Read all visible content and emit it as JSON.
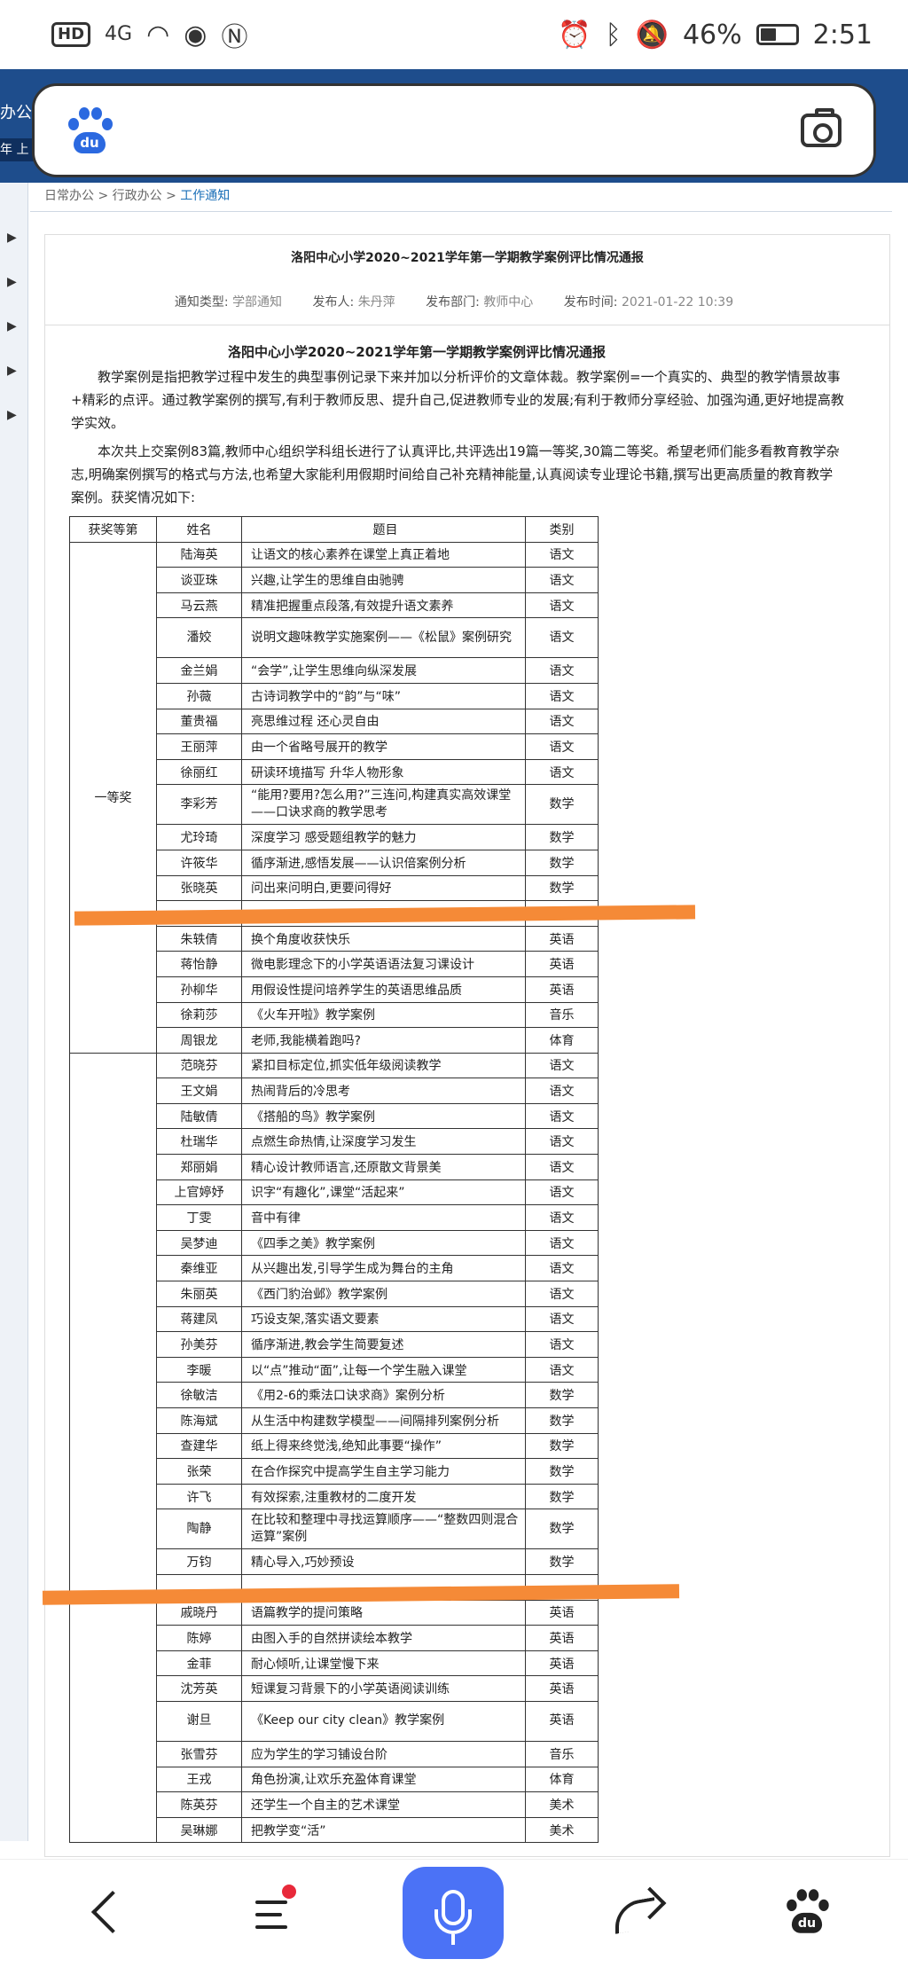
{
  "status_bar": {
    "network": "HD",
    "signal": "4G",
    "battery": "46%",
    "time": "2:51"
  },
  "left_edge": {
    "label_top": "办公",
    "label_mid": "年 上"
  },
  "search": {
    "logo_text": "du"
  },
  "breadcrumb": {
    "item1": "日常办公",
    "sep": ">",
    "item2": "行政办公",
    "item3": "工作通知"
  },
  "notice": {
    "title": "洛阳中心小学2020~2021学年第一学期教学案例评比情况通报",
    "type_label": "通知类型:",
    "type_value": "学部通知",
    "publisher_label": "发布人:",
    "publisher_value": "朱丹萍",
    "dept_label": "发布部门:",
    "dept_value": "教师中心",
    "time_label": "发布时间:",
    "time_value": "2021-01-22 10:39"
  },
  "document": {
    "title": "洛阳中心小学2020~2021学年第一学期教学案例评比情况通报",
    "paragraph1": "教学案例是指把教学过程中发生的典型事例记录下来并加以分析评价的文章体裁。教学案例=一个真实的、典型的教学情景故事+精彩的点评。通过教学案例的撰写,有利于教师反思、提升自己,促进教师专业的发展;有利于教师分享经验、加强沟通,更好地提高教学实效。",
    "paragraph2": "本次共上交案例83篇,教师中心组织学科组长进行了认真评比,共评选出19篇一等奖,30篇二等奖。希望老师们能多看教育教学杂志,明确案例撰写的格式与方法,也希望大家能利用假期时间给自己补充精神能量,认真阅读专业理论书籍,撰写出更高质量的教育教学案例。获奖情况如下:"
  },
  "table": {
    "headers": [
      "获奖等第",
      "姓名",
      "题目",
      "类别"
    ],
    "grade_first": "一等奖",
    "grade_second": "",
    "first_prize": [
      {
        "name": "陆海英",
        "title": "让语文的核心素养在课堂上真正着地",
        "cat": "语文"
      },
      {
        "name": "谈亚珠",
        "title": "兴趣,让学生的思维自由驰骋",
        "cat": "语文"
      },
      {
        "name": "马云燕",
        "title": "精准把握重点段落,有效提升语文素养",
        "cat": "语文"
      },
      {
        "name": "潘姣",
        "title": "说明文趣味教学实施案例——《松鼠》案例研究",
        "cat": "语文"
      },
      {
        "name": "金兰娟",
        "title": "“会学”,让学生思维向纵深发展",
        "cat": "语文"
      },
      {
        "name": "孙薇",
        "title": "古诗词教学中的“韵”与“味”",
        "cat": "语文"
      },
      {
        "name": "董贵福",
        "title": "亮思维过程 还心灵自由",
        "cat": "语文"
      },
      {
        "name": "王丽萍",
        "title": "由一个省略号展开的教学",
        "cat": "语文"
      },
      {
        "name": "徐丽红",
        "title": "研读环境描写 升华人物形象",
        "cat": "语文"
      },
      {
        "name": "李彩芳",
        "title": "“能用?要用?怎么用?”三连问,构建真实高效课堂——口诀求商的教学思考",
        "cat": "数学"
      },
      {
        "name": "尤玲琦",
        "title": "深度学习 感受题组教学的魅力",
        "cat": "数学"
      },
      {
        "name": "许筱华",
        "title": "循序渐进,感悟发展——认识倍案例分析",
        "cat": "数学"
      },
      {
        "name": "张晓英",
        "title": "问出来问明白,更要问得好",
        "cat": "数学"
      },
      {
        "name": "",
        "title": "",
        "cat": ""
      },
      {
        "name": "朱轶倩",
        "title": "换个角度收获快乐",
        "cat": "英语"
      },
      {
        "name": "蒋怡静",
        "title": "微电影理念下的小学英语语法复习课设计",
        "cat": "英语"
      },
      {
        "name": "孙柳华",
        "title": "用假设性提问培养学生的英语思维品质",
        "cat": "英语"
      },
      {
        "name": "徐莉莎",
        "title": "《火车开啦》教学案例",
        "cat": "音乐"
      },
      {
        "name": "周银龙",
        "title": "老师,我能横着跑吗?",
        "cat": "体育"
      }
    ],
    "second_prize": [
      {
        "name": "范晓芬",
        "title": "紧扣目标定位,抓实低年级阅读教学",
        "cat": "语文"
      },
      {
        "name": "王文娟",
        "title": "热闹背后的冷思考",
        "cat": "语文"
      },
      {
        "name": "陆敏倩",
        "title": "《搭船的鸟》教学案例",
        "cat": "语文"
      },
      {
        "name": "杜瑞华",
        "title": "点燃生命热情,让深度学习发生",
        "cat": "语文"
      },
      {
        "name": "郑丽娟",
        "title": "精心设计教师语言,还原散文背景美",
        "cat": "语文"
      },
      {
        "name": "上官婷妤",
        "title": "识字“有趣化”,课堂“活起来”",
        "cat": "语文"
      },
      {
        "name": "丁雯",
        "title": "音中有律",
        "cat": "语文"
      },
      {
        "name": "吴梦迪",
        "title": "《四季之美》教学案例",
        "cat": "语文"
      },
      {
        "name": "秦维亚",
        "title": "从兴趣出发,引导学生成为舞台的主角",
        "cat": "语文"
      },
      {
        "name": "朱丽英",
        "title": "《西门豹治邺》教学案例",
        "cat": "语文"
      },
      {
        "name": "蒋建凤",
        "title": "巧设支架,落实语文要素",
        "cat": "语文"
      },
      {
        "name": "孙美芬",
        "title": "循序渐进,教会学生简要复述",
        "cat": "语文"
      },
      {
        "name": "李暖",
        "title": "以“点”推动“面”,让每一个学生融入课堂",
        "cat": "语文"
      },
      {
        "name": "徐敏洁",
        "title": "《用2-6的乘法口诀求商》案例分析",
        "cat": "数学"
      },
      {
        "name": "陈海斌",
        "title": "从生活中构建数学模型——间隔排列案例分析",
        "cat": "数学"
      },
      {
        "name": "查建华",
        "title": "纸上得来终觉浅,绝知此事要“操作”",
        "cat": "数学"
      },
      {
        "name": "张荣",
        "title": "在合作探究中提高学生自主学习能力",
        "cat": "数学"
      },
      {
        "name": "许飞",
        "title": "有效探索,注重教材的二度开发",
        "cat": "数学"
      },
      {
        "name": "陶静",
        "title": "在比较和整理中寻找运算顺序——“整数四则混合运算”案例",
        "cat": "数学"
      },
      {
        "name": "万钧",
        "title": "精心导入,巧妙预设",
        "cat": "数学"
      },
      {
        "name": "",
        "title": "",
        "cat": ""
      },
      {
        "name": "戚晓丹",
        "title": "语篇教学的提问策略",
        "cat": "英语"
      },
      {
        "name": "陈婷",
        "title": "由图入手的自然拼读绘本教学",
        "cat": "英语"
      },
      {
        "name": "金菲",
        "title": "耐心倾听,让课堂慢下来",
        "cat": "英语"
      },
      {
        "name": "沈芳英",
        "title": "短课复习背景下的小学英语阅读训练",
        "cat": "英语"
      },
      {
        "name": "谢旦",
        "title": "《Keep our city clean》教学案例",
        "cat": "英语"
      },
      {
        "name": "张雪芬",
        "title": "应为学生的学习铺设台阶",
        "cat": "音乐"
      },
      {
        "name": "王戎",
        "title": "角色扮演,让欢乐充盈体育课堂",
        "cat": "体育"
      },
      {
        "name": "陈英芬",
        "title": "还学生一个自主的艺术课堂",
        "cat": "美术"
      },
      {
        "name": "吴琳娜",
        "title": "把教学变“活”",
        "cat": "美术"
      }
    ]
  },
  "colors": {
    "accent_blue": "#1e4d8c",
    "voice_blue": "#4b72f6",
    "highlight_orange": "#f58a37",
    "notify_red": "#e8293a"
  },
  "icons": {
    "back": "back-arrow-icon",
    "menu": "menu-icon",
    "voice": "microphone-icon",
    "share": "share-icon",
    "home": "baidu-paw-icon",
    "camera": "camera-icon"
  }
}
